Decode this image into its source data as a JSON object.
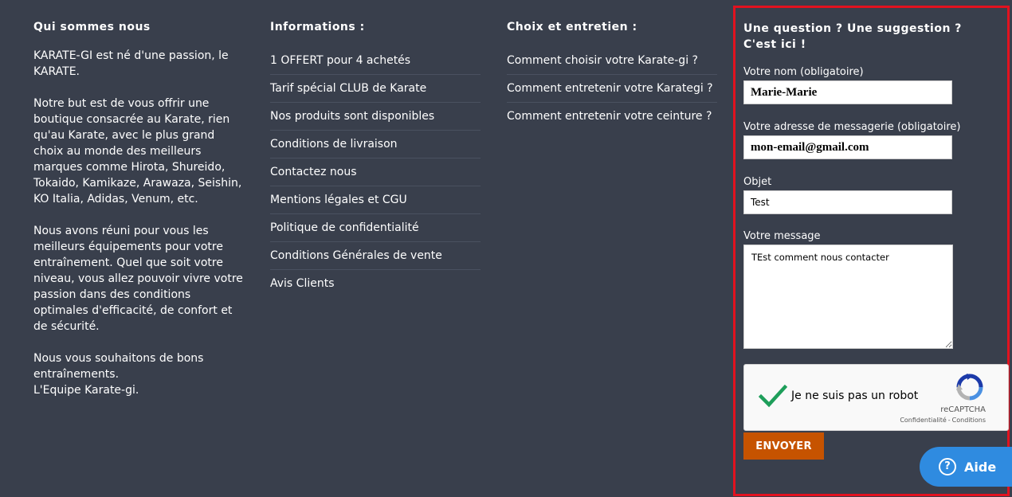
{
  "about": {
    "title": "Qui sommes nous",
    "paragraphs": [
      "KARATE-GI est né d'une passion, le KARATE.",
      "Notre but est de vous offrir une boutique consacrée au Karate, rien qu'au Karate, avec le plus grand choix au monde des meilleurs marques comme Hirota, Shureido, Tokaido, Kamikaze, Arawaza, Seishin, KO Italia, Adidas, Venum, etc.",
      "Nous avons réuni pour vous les meilleurs équipements pour votre entraînement. Quel que soit votre niveau, vous allez pouvoir vivre votre passion dans des conditions optimales d'efficacité, de confort et de sécurité.",
      "Nous vous souhaitons de bons entraînements.",
      "L'Equipe Karate-gi."
    ]
  },
  "info": {
    "title": "Informations :",
    "links": [
      "1 OFFERT pour 4 achetés",
      "Tarif spécial CLUB de Karate",
      "Nos produits sont disponibles",
      "Conditions de livraison",
      "Contactez nous",
      "Mentions légales et CGU",
      "Politique de confidentialité",
      "Conditions Générales de vente",
      "Avis Clients"
    ]
  },
  "choice": {
    "title": "Choix et entretien :",
    "links": [
      "Comment choisir votre Karate-gi ?",
      "Comment entretenir votre Karategi ?",
      "Comment entretenir votre ceinture ?"
    ]
  },
  "contact": {
    "title": "Une question ? Une suggestion ? C'est ici !",
    "name_label": "Votre nom (obligatoire)",
    "name_value": "Marie-Marie",
    "email_label": "Votre adresse de messagerie (obligatoire)",
    "email_value": "mon-email@gmail.com",
    "subject_label": "Objet",
    "subject_value": "Test",
    "message_label": "Votre message",
    "message_value": "TEst comment nous contacter",
    "captcha_label": "Je ne suis pas un robot",
    "captcha_brand": "reCAPTCHA",
    "captcha_privacy": "Confidentialité",
    "captcha_sep": "-",
    "captcha_terms": "Conditions",
    "captcha_checked": true,
    "submit_label": "ENVOYER",
    "highlight_color": "#e2121f"
  },
  "help": {
    "label": "Aide",
    "icon": "question-circle-icon"
  },
  "colors": {
    "background": "#393f4c",
    "button": "#c65300",
    "help": "#2f8be0",
    "check": "#1e9e5a"
  }
}
